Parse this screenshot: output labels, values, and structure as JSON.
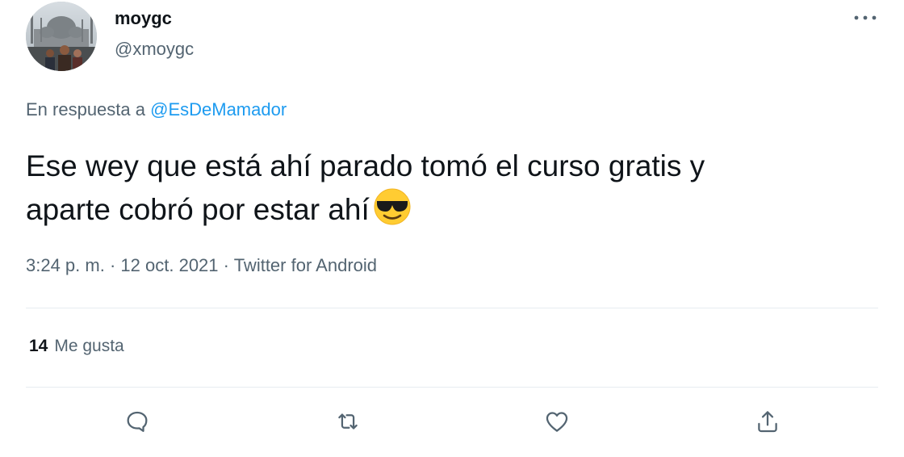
{
  "author": {
    "display_name": "moygc",
    "handle": "@xmoygc",
    "avatar_icon": "profile-photo-mosque"
  },
  "menu_icon": "more-icon",
  "reply": {
    "prefix": "En respuesta a",
    "mention": "@EsDeMamador"
  },
  "tweet": {
    "line1": "Ese wey que está ahí parado tomó el curso gratis y",
    "line2": "aparte cobró por estar ahí",
    "emoji": "smiling-face-with-sunglasses"
  },
  "meta": {
    "time": "3:24 p. m.",
    "separator": "·",
    "date": "12 oct. 2021",
    "source": "Twitter for Android"
  },
  "stats": {
    "likes_count": "14",
    "likes_label": "Me gusta"
  },
  "actions": [
    "reply-icon",
    "retweet-icon",
    "like-icon",
    "share-icon"
  ],
  "colors": {
    "text": "#0f1419",
    "secondary": "#536471",
    "link": "#1d9bf0",
    "divider": "#e6ecf0"
  }
}
